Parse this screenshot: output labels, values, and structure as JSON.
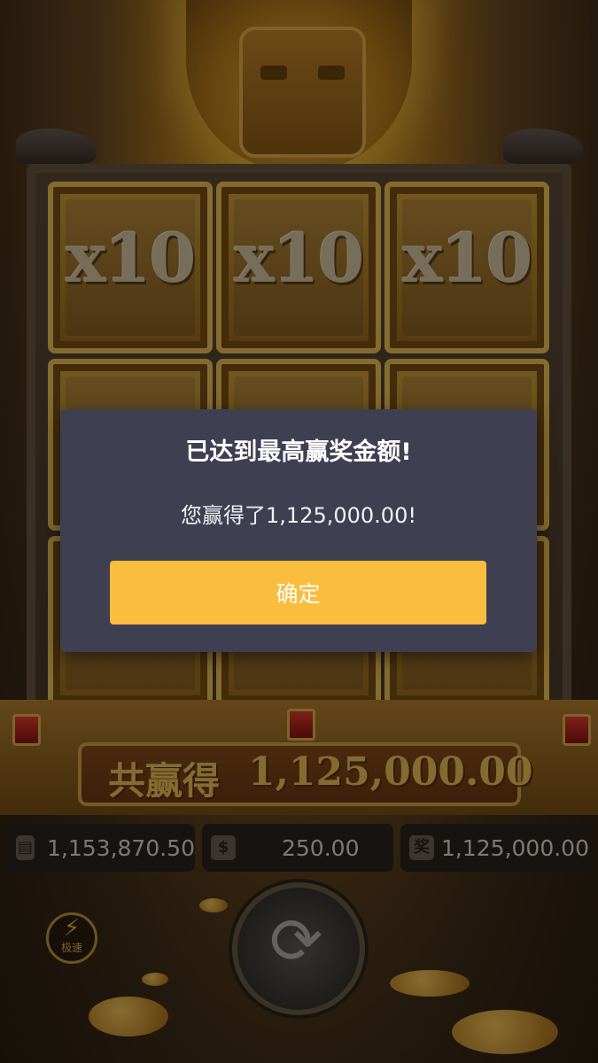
{
  "reels": {
    "multipliers": [
      "x10",
      "x10",
      "x10"
    ]
  },
  "win_banner": {
    "label": "共赢得",
    "amount": "1,125,000.00"
  },
  "info_bar": {
    "balance": "1,153,870.50",
    "bet": "250.00",
    "win": "1,125,000.00",
    "win_icon_text": "奖"
  },
  "controls": {
    "turbo_label": "极速"
  },
  "dialog": {
    "title": "已达到最高赢奖金额!",
    "message": "您赢得了1,125,000.00!",
    "confirm_label": "确定"
  },
  "colors": {
    "dialog_bg": "#3f3f52",
    "confirm_button": "#fbbd3d",
    "gold_text": "#f1c35a"
  }
}
